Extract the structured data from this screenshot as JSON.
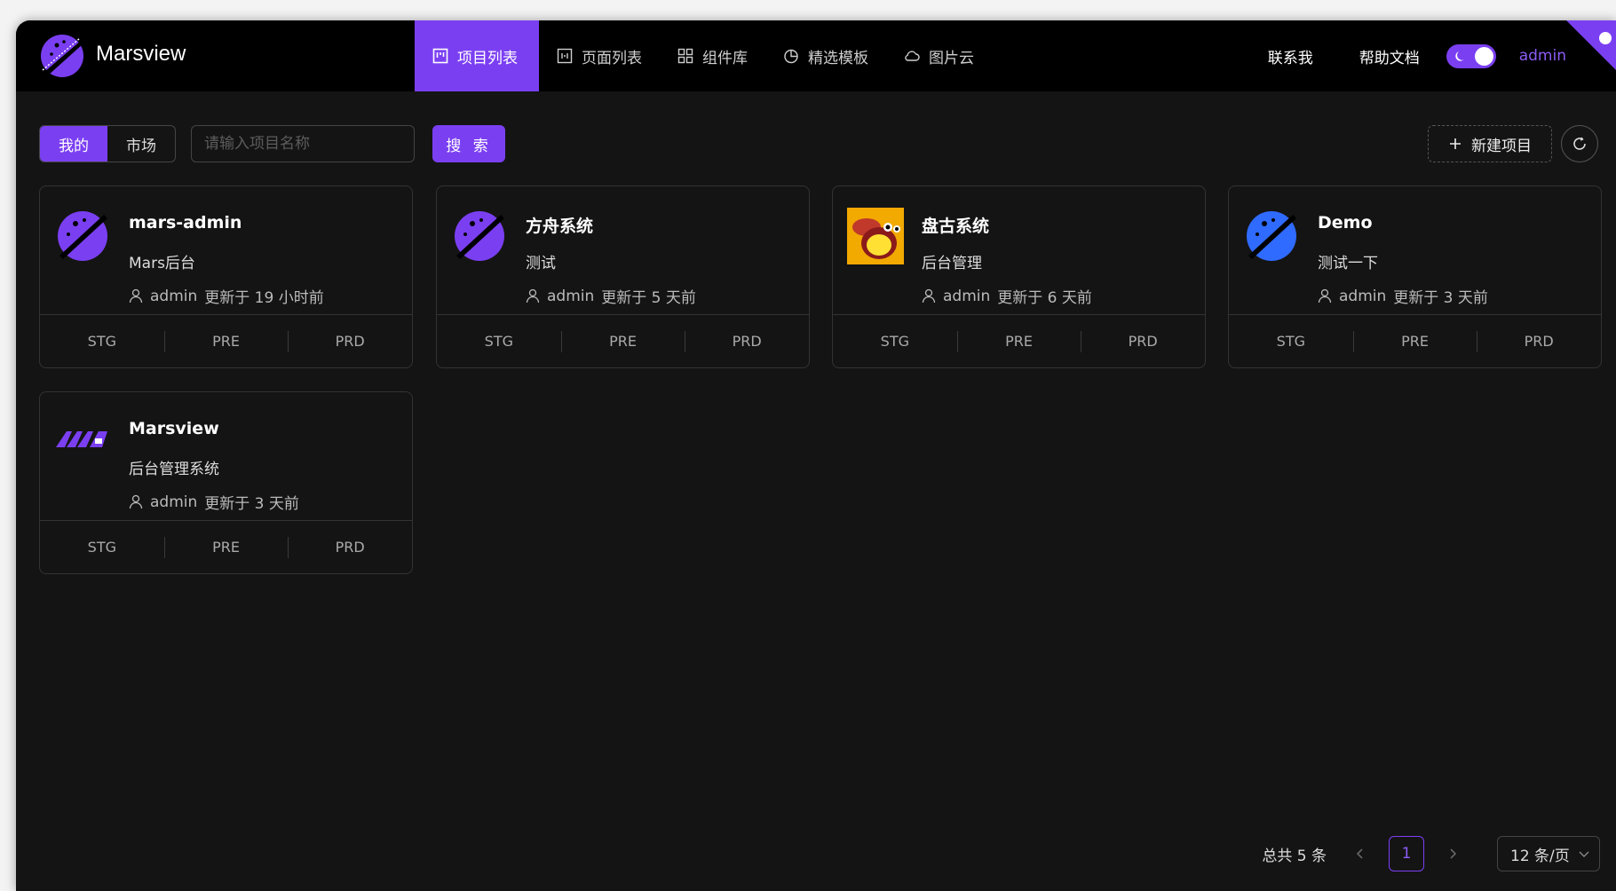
{
  "header": {
    "brand": "Marsview",
    "nav": [
      {
        "label": "项目列表",
        "icon": "board-icon",
        "active": true
      },
      {
        "label": "页面列表",
        "icon": "page-icon",
        "active": false
      },
      {
        "label": "组件库",
        "icon": "grid-icon",
        "active": false
      },
      {
        "label": "精选模板",
        "icon": "pie-icon",
        "active": false
      },
      {
        "label": "图片云",
        "icon": "cloud-icon",
        "active": false
      }
    ],
    "contact": "联系我",
    "docs": "帮助文档",
    "theme_toggle": "dark",
    "user": "admin"
  },
  "toolbar": {
    "tabs": [
      "我的",
      "市场"
    ],
    "active_tab": "我的",
    "search_placeholder": "请输入项目名称",
    "search_value": "",
    "search_label": "搜 索",
    "new_label": "新建项目"
  },
  "projects": [
    {
      "name": "mars-admin",
      "desc": "Mars后台",
      "user": "admin",
      "updated": "更新于 19 小时前",
      "logo": "planet-purple-icon",
      "envs": [
        "STG",
        "PRE",
        "PRD"
      ]
    },
    {
      "name": "方舟系统",
      "desc": "测试",
      "user": "admin",
      "updated": "更新于 5 天前",
      "logo": "planet-purple-icon",
      "envs": [
        "STG",
        "PRE",
        "PRD"
      ]
    },
    {
      "name": "盘古系统",
      "desc": "后台管理",
      "user": "admin",
      "updated": "更新于 6 天前",
      "logo": "bee-icon",
      "envs": [
        "STG",
        "PRE",
        "PRD"
      ]
    },
    {
      "name": "Demo",
      "desc": "测试一下",
      "user": "admin",
      "updated": "更新于 3 天前",
      "logo": "planet-blue-icon",
      "envs": [
        "STG",
        "PRE",
        "PRD"
      ]
    },
    {
      "name": "Marsview",
      "desc": "后台管理系统",
      "user": "admin",
      "updated": "更新于 3 天前",
      "logo": "marsview-m-icon",
      "envs": [
        "STG",
        "PRE",
        "PRD"
      ]
    }
  ],
  "pagination": {
    "total": "总共 5 条",
    "current": "1",
    "page_size": "12 条/页"
  },
  "colors": {
    "accent": "#7b3ff2",
    "background": "#141414",
    "header": "#000000",
    "blue": "#2f6bff"
  }
}
